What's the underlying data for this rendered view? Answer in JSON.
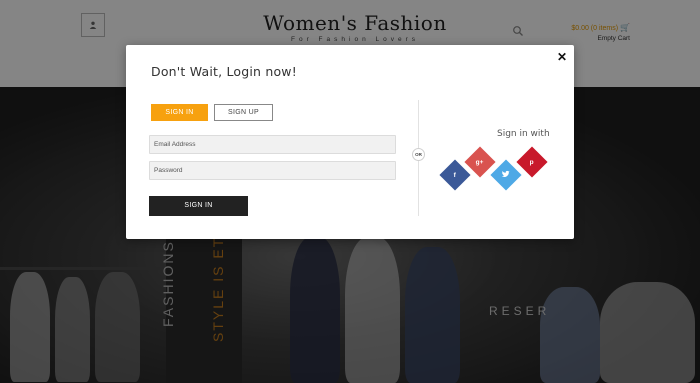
{
  "header": {
    "logo_title": "Women's Fashion",
    "logo_tagline": "For Fashion Lovers",
    "account_icon": "user-icon",
    "search_icon": "search-icon",
    "cart_total": "$0.00 (0 items)",
    "cart_status": "Empty Cart",
    "cart_icon": "cart-icon",
    "accent_color": "#e69a00"
  },
  "hero": {
    "line1": "FASHIONS FADE,",
    "line2": "STYLE IS ETER",
    "store_sign": "RESER"
  },
  "modal": {
    "title": "Don't Wait, Login now!",
    "close_icon": "close-icon",
    "close_label": "✕",
    "tabs": {
      "signin": "SIGN IN",
      "signup": "SIGN UP",
      "active": "signin"
    },
    "email_placeholder": "Email Address",
    "password_placeholder": "Password",
    "submit_label": "SIGN IN",
    "or_label": "OR",
    "social_heading": "Sign in with",
    "social": [
      {
        "name": "facebook",
        "glyph": "f",
        "color": "#3b5998"
      },
      {
        "name": "google-plus",
        "glyph": "g+",
        "color": "#d9534f"
      },
      {
        "name": "twitter",
        "glyph": "🐦",
        "color": "#4ea9e6"
      },
      {
        "name": "pinterest",
        "glyph": "p",
        "color": "#c8192b"
      }
    ],
    "button_color": "#f7a10f"
  }
}
